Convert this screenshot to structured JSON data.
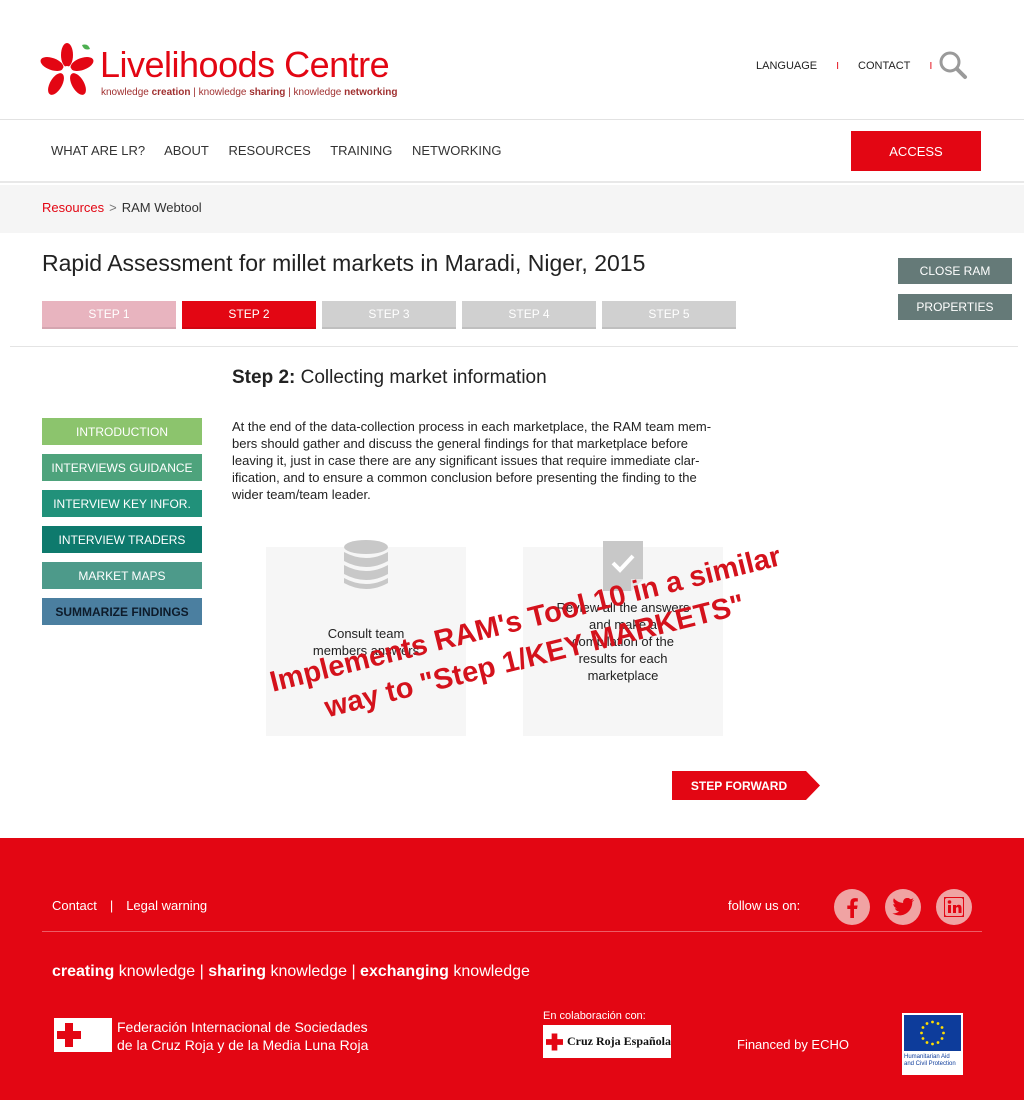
{
  "header": {
    "logo_title": "Livelihoods Centre",
    "logo_tag": {
      "p1": "knowledge ",
      "b1": "creation",
      "p2": " | knowledge ",
      "b2": "sharing",
      "p3": " | knowledge ",
      "b3": "networking"
    },
    "language_label": "LANGUAGE",
    "contact_label": "CONTACT",
    "separator": "I",
    "search_icon": "search-icon"
  },
  "nav": {
    "items": [
      "WHAT ARE LR?",
      "ABOUT",
      "RESOURCES",
      "TRAINING",
      "NETWORKING"
    ],
    "access_label": "ACCESS"
  },
  "breadcrumb": {
    "link": "Resources",
    "separator": ">",
    "current": "RAM Webtool"
  },
  "page": {
    "title": "Rapid Assessment for millet markets in Maradi, Niger, 2015",
    "close_label": "CLOSE RAM",
    "properties_label": "PROPERTIES",
    "steps": [
      "STEP 1",
      "STEP 2",
      "STEP 3",
      "STEP 4",
      "STEP 5"
    ],
    "step_heading_bold": "Step 2:",
    "step_heading_text": " Collecting market information",
    "step_text": [
      "At the end of the data-collection process in each marketplace, the RAM team mem-",
      "bers should gather and discuss the general findings for that marketplace before",
      "leaving it, just in case there are any significant issues that require immediate clar-",
      "ification, and to ensure a common conclusion before presenting the finding to the",
      "wider team/team leader."
    ],
    "menu": [
      {
        "label": "INTRODUCTION",
        "color": "#8cc46d"
      },
      {
        "label": "INTERVIEWS GUIDANCE",
        "color": "#4ea37c"
      },
      {
        "label": "INTERVIEW KEY INFOR.",
        "color": "#21917a"
      },
      {
        "label": "INTERVIEW TRADERS",
        "color": "#0e7a6d"
      },
      {
        "label": "MARKET MAPS",
        "color": "#4d9a8a"
      },
      {
        "label": "SUMMARIZE FINDINGS",
        "color": "#4b7fa0"
      }
    ],
    "card1": {
      "icon": "database-icon",
      "lines": [
        "Consult team",
        "members answers"
      ]
    },
    "card2": {
      "icon": "document-check-icon",
      "lines": [
        "Review all the answers",
        "and make a",
        "compilation of the",
        "results for each",
        "marketplace"
      ]
    },
    "watermark": [
      "Implements RAM's Tool 10 in a similar",
      "way to \"Step 1/KEY MARKETS\""
    ],
    "forward_label": "STEP FORWARD"
  },
  "footer": {
    "contact": "Contact",
    "pipe": "|",
    "legal": "Legal warning",
    "follow": "follow us on:",
    "social": [
      "facebook-icon",
      "twitter-icon",
      "linkedin-icon"
    ],
    "motto": {
      "b1": "creating",
      "p1": " knowledge | ",
      "b2": "sharing",
      "p2": " knowledge | ",
      "b3": "exchanging",
      "p3": " knowledge"
    },
    "ifrc_line1": "Federación Internacional de Sociedades",
    "ifrc_line2": "de la Cruz Roja y de la Media Luna Roja",
    "colab": "En colaboración con:",
    "cre_name": "Cruz Roja Española",
    "echo": "Financed by ECHO",
    "eu_caption": "Humanitarian Aid and Civil Protection"
  },
  "colors": {
    "brand_red": "#e30613",
    "step_done": "#e8b4bf",
    "step_todo": "#d0d0d0",
    "side_button": "#657a78",
    "card_bg": "#f6f6f6"
  }
}
